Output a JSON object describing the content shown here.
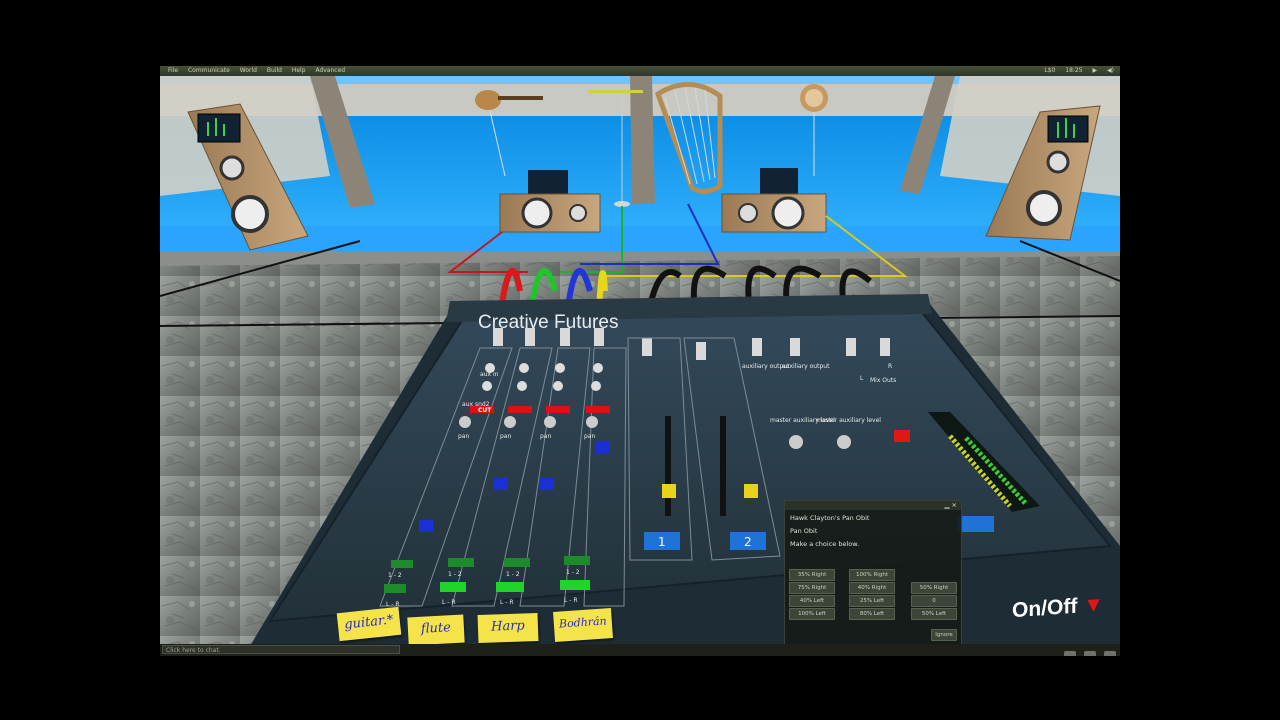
{
  "menu": {
    "items": [
      "File",
      "Communicate",
      "World",
      "Build",
      "Help",
      "Advanced"
    ],
    "clock": "18:25",
    "balance": "L$0"
  },
  "mixer": {
    "brand": "Creative Futures",
    "channel_knobs": [
      "mic in",
      "aux in",
      "aux snd1",
      "aux snd2"
    ],
    "cut_label": "CUT",
    "pan_label": "pan",
    "route_12": "1 - 2",
    "route_lr": "L - R",
    "aux_output": "auxiliary output",
    "master_aux": "master auxiliary level",
    "mix_outs": "Mix Outs",
    "mix_l": "L",
    "mix_r": "R",
    "group_buttons": [
      "1",
      "2"
    ],
    "onoff": "On/Off"
  },
  "instruments": [
    "guitar.*",
    "flute",
    "Harp",
    "Bodhrán"
  ],
  "dialog": {
    "title": "Hawk Clayton's Pan Obit",
    "subtitle": "Pan Obit",
    "prompt": "Make a choice below.",
    "buttons": [
      "35% Right",
      "100% Right",
      "75% Right",
      "40% Right",
      "50% Right",
      "40% Left",
      "25% Left",
      "0",
      "100% Left",
      "80% Left",
      "50% Left"
    ],
    "ignore": "Ignore"
  },
  "chat": {
    "placeholder": "Click here to chat."
  },
  "colors": {
    "water": "#1e9ff0",
    "mixer_panel": "#2d3e4a",
    "fader_blue": "#1a2fd6",
    "fader_yellow": "#e8d21c",
    "fader_red": "#e01717",
    "button_green": "#21d42a",
    "sticky_yellow": "#f4e44a"
  }
}
